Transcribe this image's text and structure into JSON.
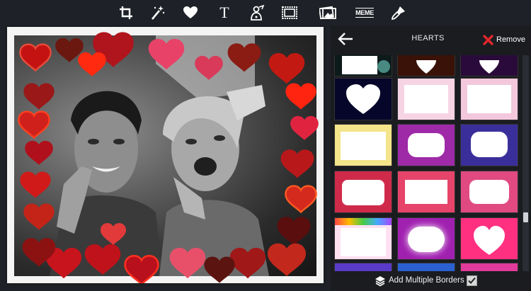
{
  "toolbar": {
    "tools": [
      {
        "name": "crop-icon"
      },
      {
        "name": "magic-wand-icon"
      },
      {
        "name": "heart-icon"
      },
      {
        "name": "text-icon"
      },
      {
        "name": "sticker-icon"
      },
      {
        "name": "frame-icon"
      },
      {
        "name": "image-icon"
      },
      {
        "name": "meme-icon"
      },
      {
        "name": "brush-icon"
      }
    ],
    "text_glyph": "T",
    "meme_label": "MEME"
  },
  "panel": {
    "title": "HEARTS",
    "remove_label": "Remove"
  },
  "footer": {
    "label": "Add Multiple Borders",
    "checked": true
  },
  "colors": {
    "background": "#1e2127",
    "remove_x": "#e0262c",
    "scroll_thumb": "#cfd2d6"
  }
}
